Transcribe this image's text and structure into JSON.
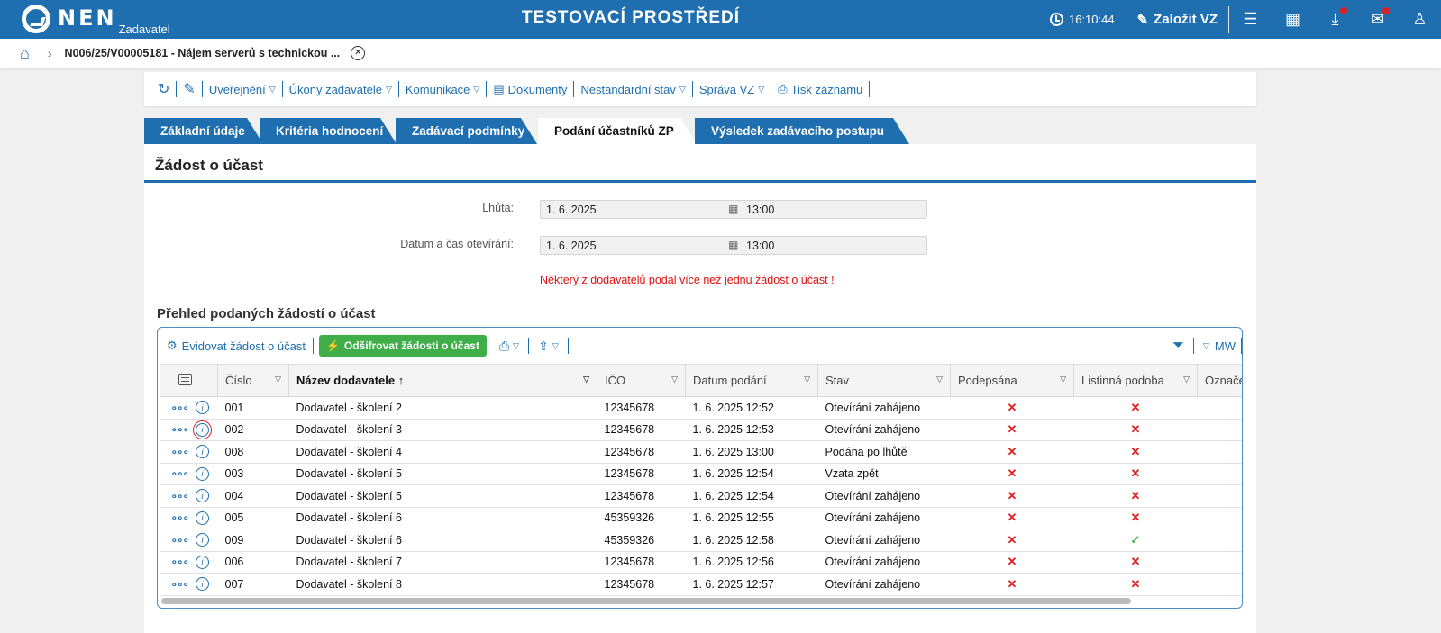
{
  "header": {
    "logo_name": "NEN",
    "logo_sub": "Zadavatel",
    "env_title": "TESTOVACÍ PROSTŘEDÍ",
    "time": "16:10:44",
    "create_label": "Založit VZ"
  },
  "breadcrumb": {
    "title": "N006/25/V00005181 - Nájem serverů s technickou ..."
  },
  "actions": {
    "publish": "Uveřejnění",
    "tasks": "Úkony zadavatele",
    "communication": "Komunikace",
    "documents": "Dokumenty",
    "nonstandard": "Nestandardní stav",
    "management": "Správa VZ",
    "print": "Tisk záznamu"
  },
  "tabs": [
    {
      "label": "Základní údaje"
    },
    {
      "label": "Kritéria hodnocení"
    },
    {
      "label": "Zadávací podmínky"
    },
    {
      "label": "Podání účastníků ZP"
    },
    {
      "label": "Výsledek zadávacího postupu"
    }
  ],
  "section": {
    "title": "Žádost o účast",
    "deadline_label": "Lhůta:",
    "deadline_date": "1. 6. 2025",
    "deadline_time": "13:00",
    "opening_label": "Datum a čas otevírání:",
    "opening_date": "1. 6. 2025",
    "opening_time": "13:00",
    "warning": "Některý z dodavatelů podal více než jednu žádost o účast !",
    "overview_title": "Přehled podaných žádostí o účast"
  },
  "grid": {
    "register_label": "Evidovat žádost o účast",
    "decrypt_label": "Odšifrovat žádosti o účast",
    "mw_label": "MW",
    "columns": [
      "Číslo",
      "Název dodavatele",
      "IČO",
      "Datum podání",
      "Stav",
      "Podepsána",
      "Listinná podoba",
      "Označení"
    ],
    "rows": [
      {
        "cislo": "001",
        "nazev": "Dodavatel - školení 2",
        "ico": "12345678",
        "datum": "1. 6. 2025 12:52",
        "stav": "Otevírání zahájeno",
        "podepsana": "✕",
        "listinna": "✕"
      },
      {
        "cislo": "002",
        "nazev": "Dodavatel - školení 3",
        "ico": "12345678",
        "datum": "1. 6. 2025 12:53",
        "stav": "Otevírání zahájeno",
        "podepsana": "✕",
        "listinna": "✕"
      },
      {
        "cislo": "008",
        "nazev": "Dodavatel - školení 4",
        "ico": "12345678",
        "datum": "1. 6. 2025 13:00",
        "stav": "Podána po lhůtě",
        "podepsana": "✕",
        "listinna": "✕"
      },
      {
        "cislo": "003",
        "nazev": "Dodavatel - školení 5",
        "ico": "12345678",
        "datum": "1. 6. 2025 12:54",
        "stav": "Vzata zpět",
        "podepsana": "✕",
        "listinna": "✕"
      },
      {
        "cislo": "004",
        "nazev": "Dodavatel - školení 5",
        "ico": "12345678",
        "datum": "1. 6. 2025 12:54",
        "stav": "Otevírání zahájeno",
        "podepsana": "✕",
        "listinna": "✕"
      },
      {
        "cislo": "005",
        "nazev": "Dodavatel - školení 6",
        "ico": "45359326",
        "datum": "1. 6. 2025 12:55",
        "stav": "Otevírání zahájeno",
        "podepsana": "✕",
        "listinna": "✕"
      },
      {
        "cislo": "009",
        "nazev": "Dodavatel - školení 6",
        "ico": "45359326",
        "datum": "1. 6. 2025 12:58",
        "stav": "Otevírání zahájeno",
        "podepsana": "✕",
        "listinna": "✓"
      },
      {
        "cislo": "006",
        "nazev": "Dodavatel - školení 7",
        "ico": "12345678",
        "datum": "1. 6. 2025 12:56",
        "stav": "Otevírání zahájeno",
        "podepsana": "✕",
        "listinna": "✕"
      },
      {
        "cislo": "007",
        "nazev": "Dodavatel - školení 8",
        "ico": "12345678",
        "datum": "1. 6. 2025 12:57",
        "stav": "Otevírání zahájeno",
        "podepsana": "✕",
        "listinna": "✕"
      }
    ]
  },
  "colors": {
    "primary": "#1f6fb0",
    "success": "#3fae49",
    "danger": "#e02020"
  }
}
